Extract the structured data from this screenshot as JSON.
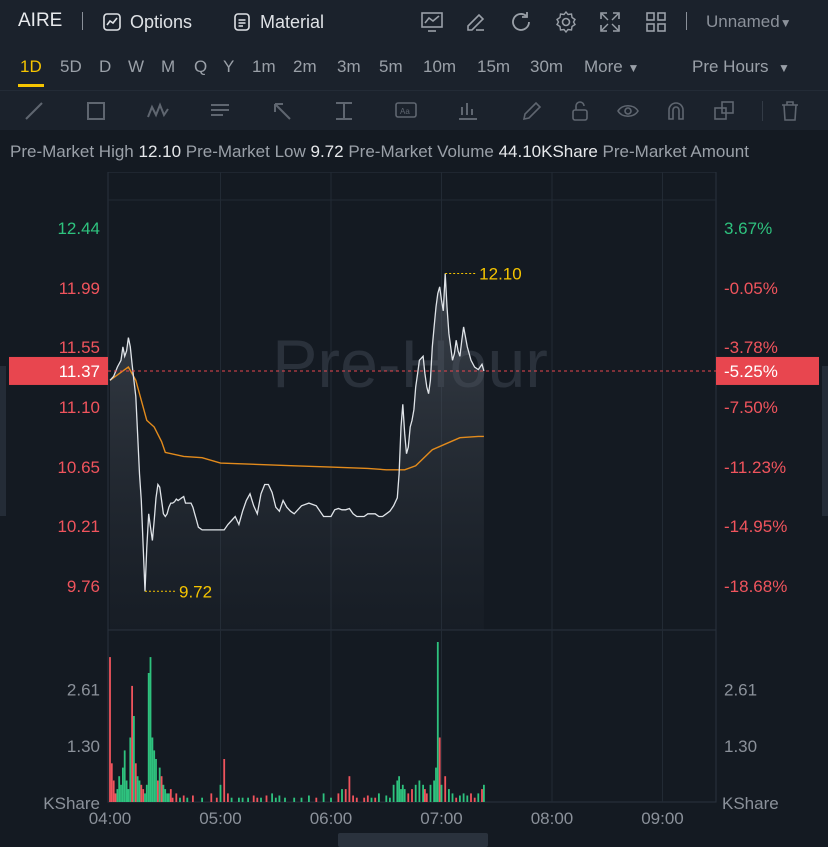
{
  "header": {
    "ticker": "AIRE",
    "options_label": "Options",
    "material_label": "Material",
    "layout_name": "Unnamed",
    "icons": [
      "chart-settings-icon",
      "edit-icon",
      "refresh-icon",
      "gear-icon",
      "fullscreen-icon",
      "grid-layout-icon"
    ]
  },
  "periods": {
    "items": [
      "1D",
      "5D",
      "D",
      "W",
      "M",
      "Q",
      "Y",
      "1m",
      "2m",
      "3m",
      "5m",
      "10m",
      "15m",
      "30m"
    ],
    "active": "1D",
    "more_label": "More",
    "session_label": "Pre Hours"
  },
  "drawing_tools": [
    "line-tool-icon",
    "rectangle-tool-icon",
    "wave-tool-icon",
    "text-list-tool-icon",
    "arrow-tool-icon",
    "price-range-tool-icon",
    "text-tool-icon",
    "indicator-tool-icon",
    "brush-icon",
    "lock-icon",
    "eye-icon",
    "magnet-icon",
    "copy-icon",
    "trash-icon"
  ],
  "stats": {
    "high_label": "Pre-Market High",
    "high_value": "12.10",
    "low_label": "Pre-Market Low",
    "low_value": "9.72",
    "volume_label": "Pre-Market Volume",
    "volume_value": "44.10KShare",
    "amount_label": "Pre-Market Amount"
  },
  "colors": {
    "up": "#2ec27e",
    "down": "#f0545d",
    "price_line": "#dfe3e8",
    "avg_line": "#e38b1c",
    "marker": "#f5c400",
    "current_bg": "#e8464f"
  },
  "chart_data": {
    "type": "line",
    "watermark": "Pre-Hour",
    "current_price": 11.37,
    "current_pct": "-5.25%",
    "high_marker": "12.10",
    "low_marker": "9.72",
    "price_ticks": [
      {
        "v": 12.44,
        "label": "12.44",
        "pct": "3.67%",
        "dir": "up"
      },
      {
        "v": 11.99,
        "label": "11.99",
        "pct": "-0.05%",
        "dir": "down"
      },
      {
        "v": 11.55,
        "label": "11.55",
        "pct": "-3.78%",
        "dir": "down"
      },
      {
        "v": 11.1,
        "label": "11.10",
        "pct": "-7.50%",
        "dir": "down"
      },
      {
        "v": 10.65,
        "label": "10.65",
        "pct": "-11.23%",
        "dir": "down"
      },
      {
        "v": 10.21,
        "label": "10.21",
        "pct": "-14.95%",
        "dir": "down"
      },
      {
        "v": 9.76,
        "label": "9.76",
        "pct": "-18.68%",
        "dir": "down"
      }
    ],
    "volume_ticks": [
      {
        "v": 2.61,
        "label": "2.61"
      },
      {
        "v": 1.3,
        "label": "1.30"
      }
    ],
    "volume_unit": "KShare",
    "time_ticks": [
      "04:00",
      "05:00",
      "06:00",
      "07:00",
      "08:00",
      "09:00"
    ],
    "x_range_minutes": [
      0,
      300
    ],
    "price_range": [
      9.43,
      12.86
    ],
    "volume_max": 3.72,
    "price": [
      [
        0,
        11.3
      ],
      [
        2,
        11.33
      ],
      [
        4,
        11.4
      ],
      [
        6,
        11.45
      ],
      [
        7,
        11.55
      ],
      [
        8,
        11.48
      ],
      [
        9,
        11.52
      ],
      [
        10,
        11.62
      ],
      [
        11,
        11.55
      ],
      [
        12,
        11.42
      ],
      [
        13,
        11.3
      ],
      [
        14,
        11.18
      ],
      [
        15,
        10.9
      ],
      [
        16,
        10.6
      ],
      [
        17,
        10.4
      ],
      [
        18,
        10.05
      ],
      [
        19,
        9.72
      ],
      [
        20,
        10.05
      ],
      [
        21,
        10.3
      ],
      [
        22,
        10.2
      ],
      [
        23,
        10.1
      ],
      [
        24,
        10.25
      ],
      [
        25,
        10.42
      ],
      [
        26,
        10.52
      ],
      [
        27,
        10.5
      ],
      [
        28,
        10.4
      ],
      [
        29,
        10.3
      ],
      [
        30,
        10.28
      ],
      [
        31,
        10.3
      ],
      [
        32,
        10.35
      ],
      [
        33,
        10.38
      ],
      [
        34,
        10.38
      ],
      [
        35,
        10.39
      ],
      [
        36,
        10.41
      ],
      [
        37,
        10.4
      ],
      [
        38,
        10.41
      ],
      [
        39,
        10.42
      ],
      [
        40,
        10.43
      ],
      [
        41,
        10.38
      ],
      [
        42,
        10.38
      ],
      [
        43,
        10.38
      ],
      [
        44,
        10.38
      ],
      [
        45,
        10.35
      ],
      [
        46,
        10.3
      ],
      [
        47,
        10.25
      ],
      [
        48,
        10.2
      ],
      [
        50,
        10.18
      ],
      [
        52,
        10.18
      ],
      [
        54,
        10.18
      ],
      [
        56,
        10.18
      ],
      [
        58,
        10.18
      ],
      [
        60,
        10.18
      ],
      [
        62,
        10.18
      ],
      [
        64,
        10.22
      ],
      [
        66,
        10.25
      ],
      [
        68,
        10.28
      ],
      [
        70,
        10.22
      ],
      [
        72,
        10.32
      ],
      [
        74,
        10.4
      ],
      [
        76,
        10.45
      ],
      [
        78,
        10.36
      ],
      [
        80,
        10.3
      ],
      [
        82,
        10.45
      ],
      [
        84,
        10.52
      ],
      [
        86,
        10.52
      ],
      [
        88,
        10.46
      ],
      [
        90,
        10.35
      ],
      [
        92,
        10.32
      ],
      [
        94,
        10.4
      ],
      [
        96,
        10.35
      ],
      [
        98,
        10.32
      ],
      [
        100,
        10.3
      ],
      [
        104,
        10.36
      ],
      [
        108,
        10.38
      ],
      [
        112,
        10.36
      ],
      [
        116,
        10.28
      ],
      [
        118,
        10.28
      ],
      [
        120,
        10.28
      ],
      [
        122,
        10.33
      ],
      [
        124,
        10.34
      ],
      [
        126,
        10.33
      ],
      [
        128,
        10.33
      ],
      [
        130,
        10.34
      ],
      [
        132,
        10.3
      ],
      [
        134,
        10.28
      ],
      [
        136,
        10.28
      ],
      [
        138,
        10.28
      ],
      [
        140,
        10.3
      ],
      [
        142,
        10.3
      ],
      [
        144,
        10.3
      ],
      [
        146,
        10.28
      ],
      [
        148,
        10.28
      ],
      [
        150,
        10.3
      ],
      [
        152,
        10.32
      ],
      [
        154,
        10.36
      ],
      [
        156,
        10.42
      ],
      [
        157,
        10.6
      ],
      [
        158,
        10.95
      ],
      [
        159,
        11.12
      ],
      [
        160,
        10.9
      ],
      [
        161,
        10.75
      ],
      [
        162,
        10.8
      ],
      [
        163,
        10.95
      ],
      [
        164,
        11.0
      ],
      [
        165,
        11.08
      ],
      [
        166,
        11.25
      ],
      [
        167,
        11.35
      ],
      [
        168,
        11.45
      ],
      [
        170,
        11.48
      ],
      [
        171,
        11.35
      ],
      [
        172,
        11.25
      ],
      [
        173,
        11.2
      ],
      [
        174,
        11.3
      ],
      [
        175,
        11.55
      ],
      [
        176,
        11.7
      ],
      [
        177,
        11.85
      ],
      [
        178,
        11.95
      ],
      [
        179,
        12.0
      ],
      [
        180,
        11.9
      ],
      [
        181,
        11.82
      ],
      [
        182,
        12.1
      ],
      [
        183,
        11.85
      ],
      [
        184,
        11.65
      ],
      [
        185,
        11.55
      ],
      [
        186,
        11.45
      ],
      [
        187,
        11.5
      ],
      [
        188,
        11.6
      ],
      [
        189,
        11.52
      ],
      [
        190,
        11.48
      ],
      [
        191,
        11.6
      ],
      [
        192,
        11.7
      ],
      [
        194,
        11.55
      ],
      [
        196,
        11.45
      ],
      [
        198,
        11.4
      ],
      [
        200,
        11.38
      ],
      [
        202,
        11.42
      ],
      [
        203,
        11.37
      ]
    ],
    "average": [
      [
        0,
        11.3
      ],
      [
        10,
        11.4
      ],
      [
        14,
        11.3
      ],
      [
        20,
        11.0
      ],
      [
        24,
        10.95
      ],
      [
        28,
        10.84
      ],
      [
        30,
        10.76
      ],
      [
        40,
        10.73
      ],
      [
        50,
        10.72
      ],
      [
        60,
        10.68
      ],
      [
        80,
        10.67
      ],
      [
        100,
        10.66
      ],
      [
        120,
        10.65
      ],
      [
        140,
        10.64
      ],
      [
        150,
        10.63
      ],
      [
        160,
        10.63
      ],
      [
        166,
        10.66
      ],
      [
        175,
        10.78
      ],
      [
        185,
        10.84
      ],
      [
        190,
        10.87
      ],
      [
        200,
        10.88
      ],
      [
        203,
        10.88
      ]
    ],
    "volume": [
      [
        0,
        3.37,
        "down"
      ],
      [
        1,
        0.9,
        "down"
      ],
      [
        2,
        0.5,
        "down"
      ],
      [
        3,
        0.2,
        "down"
      ],
      [
        4,
        0.3,
        "up"
      ],
      [
        5,
        0.6,
        "up"
      ],
      [
        6,
        0.4,
        "up"
      ],
      [
        7,
        0.8,
        "up"
      ],
      [
        8,
        1.2,
        "up"
      ],
      [
        9,
        0.5,
        "up"
      ],
      [
        10,
        0.3,
        "up"
      ],
      [
        11,
        1.5,
        "up"
      ],
      [
        12,
        2.7,
        "down"
      ],
      [
        13,
        2.0,
        "up"
      ],
      [
        14,
        0.9,
        "down"
      ],
      [
        15,
        0.6,
        "up"
      ],
      [
        16,
        0.5,
        "up"
      ],
      [
        17,
        0.4,
        "down"
      ],
      [
        18,
        0.3,
        "down"
      ],
      [
        19,
        0.2,
        "up"
      ],
      [
        20,
        0.4,
        "up"
      ],
      [
        21,
        3.0,
        "up"
      ],
      [
        22,
        3.37,
        "up"
      ],
      [
        23,
        1.5,
        "up"
      ],
      [
        24,
        1.2,
        "up"
      ],
      [
        25,
        1.0,
        "up"
      ],
      [
        26,
        0.5,
        "down"
      ],
      [
        27,
        0.8,
        "up"
      ],
      [
        28,
        0.6,
        "down"
      ],
      [
        29,
        0.4,
        "up"
      ],
      [
        30,
        0.3,
        "up"
      ],
      [
        31,
        0.2,
        "up"
      ],
      [
        32,
        0.2,
        "up"
      ],
      [
        33,
        0.3,
        "down"
      ],
      [
        34,
        0.1,
        "down"
      ],
      [
        36,
        0.2,
        "down"
      ],
      [
        38,
        0.1,
        "up"
      ],
      [
        40,
        0.15,
        "down"
      ],
      [
        42,
        0.1,
        "up"
      ],
      [
        45,
        0.15,
        "down"
      ],
      [
        50,
        0.1,
        "up"
      ],
      [
        55,
        0.2,
        "down"
      ],
      [
        58,
        0.1,
        "down"
      ],
      [
        60,
        0.4,
        "up"
      ],
      [
        62,
        1.0,
        "down"
      ],
      [
        64,
        0.2,
        "down"
      ],
      [
        66,
        0.1,
        "up"
      ],
      [
        70,
        0.1,
        "up"
      ],
      [
        72,
        0.1,
        "up"
      ],
      [
        75,
        0.1,
        "up"
      ],
      [
        78,
        0.15,
        "down"
      ],
      [
        80,
        0.1,
        "down"
      ],
      [
        82,
        0.1,
        "up"
      ],
      [
        85,
        0.15,
        "down"
      ],
      [
        88,
        0.2,
        "up"
      ],
      [
        90,
        0.1,
        "up"
      ],
      [
        92,
        0.15,
        "up"
      ],
      [
        95,
        0.1,
        "up"
      ],
      [
        100,
        0.1,
        "up"
      ],
      [
        104,
        0.1,
        "up"
      ],
      [
        108,
        0.15,
        "up"
      ],
      [
        112,
        0.1,
        "down"
      ],
      [
        116,
        0.2,
        "up"
      ],
      [
        120,
        0.1,
        "up"
      ],
      [
        124,
        0.2,
        "down"
      ],
      [
        126,
        0.3,
        "up"
      ],
      [
        128,
        0.3,
        "down"
      ],
      [
        130,
        0.6,
        "down"
      ],
      [
        132,
        0.15,
        "down"
      ],
      [
        134,
        0.1,
        "down"
      ],
      [
        138,
        0.1,
        "down"
      ],
      [
        140,
        0.15,
        "down"
      ],
      [
        142,
        0.1,
        "up"
      ],
      [
        144,
        0.1,
        "down"
      ],
      [
        146,
        0.2,
        "up"
      ],
      [
        150,
        0.15,
        "up"
      ],
      [
        152,
        0.1,
        "up"
      ],
      [
        154,
        0.4,
        "up"
      ],
      [
        156,
        0.5,
        "up"
      ],
      [
        157,
        0.6,
        "up"
      ],
      [
        158,
        0.3,
        "up"
      ],
      [
        159,
        0.4,
        "up"
      ],
      [
        160,
        0.3,
        "up"
      ],
      [
        162,
        0.2,
        "down"
      ],
      [
        164,
        0.3,
        "down"
      ],
      [
        166,
        0.4,
        "up"
      ],
      [
        168,
        0.5,
        "up"
      ],
      [
        170,
        0.4,
        "up"
      ],
      [
        171,
        0.3,
        "down"
      ],
      [
        172,
        0.2,
        "down"
      ],
      [
        174,
        0.4,
        "up"
      ],
      [
        176,
        0.5,
        "up"
      ],
      [
        177,
        0.8,
        "up"
      ],
      [
        178,
        3.72,
        "up"
      ],
      [
        179,
        1.5,
        "down"
      ],
      [
        180,
        0.4,
        "up"
      ],
      [
        182,
        0.6,
        "down"
      ],
      [
        184,
        0.3,
        "up"
      ],
      [
        186,
        0.2,
        "up"
      ],
      [
        188,
        0.1,
        "down"
      ],
      [
        190,
        0.15,
        "up"
      ],
      [
        192,
        0.2,
        "up"
      ],
      [
        194,
        0.15,
        "up"
      ],
      [
        196,
        0.2,
        "down"
      ],
      [
        198,
        0.1,
        "down"
      ],
      [
        200,
        0.2,
        "up"
      ],
      [
        202,
        0.3,
        "down"
      ],
      [
        203,
        0.4,
        "up"
      ]
    ]
  }
}
